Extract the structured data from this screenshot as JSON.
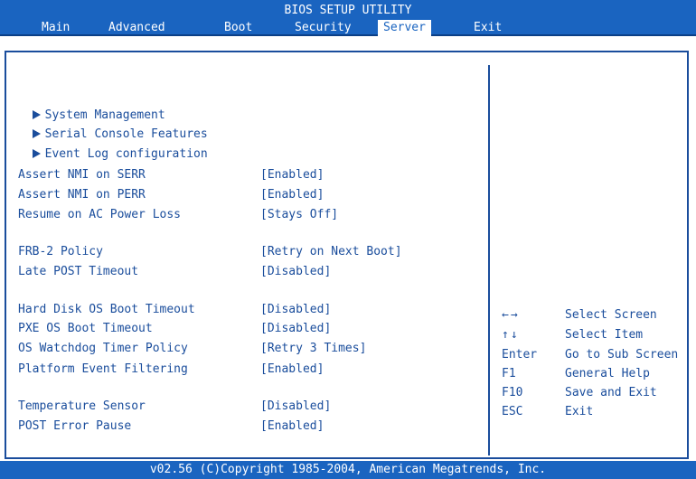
{
  "title": "BIOS SETUP UTILITY",
  "menu": [
    {
      "label": "Main"
    },
    {
      "label": "Advanced"
    },
    {
      "label": "Boot"
    },
    {
      "label": "Security"
    },
    {
      "label": "Server"
    },
    {
      "label": "Exit"
    }
  ],
  "active_menu": "Server",
  "submenus": [
    {
      "label": "System Management"
    },
    {
      "label": "Serial Console Features"
    },
    {
      "label": "Event Log configuration"
    }
  ],
  "settings": [
    {
      "label": "Assert NMI on SERR",
      "value": "[Enabled]"
    },
    {
      "label": "Assert NMI on PERR",
      "value": "[Enabled]"
    },
    {
      "label": "Resume on AC Power Loss",
      "value": "[Stays Off]"
    },
    {
      "label": "FRB-2 Policy",
      "value": "[Retry on Next Boot]"
    },
    {
      "label": "Late POST Timeout",
      "value": "[Disabled]"
    },
    {
      "label": "Hard Disk OS Boot Timeout",
      "value": "[Disabled]"
    },
    {
      "label": "PXE OS Boot Timeout",
      "value": "[Disabled]"
    },
    {
      "label": "OS Watchdog Timer Policy",
      "value": "[Retry 3 Times]"
    },
    {
      "label": "Platform Event Filtering",
      "value": "[Enabled]"
    },
    {
      "label": "Temperature Sensor",
      "value": "[Disabled]"
    },
    {
      "label": "POST Error Pause",
      "value": "[Enabled]"
    }
  ],
  "help": [
    {
      "key": "←→",
      "desc": "Select Screen"
    },
    {
      "key": "↑↓",
      "desc": "Select Item"
    },
    {
      "key": "Enter",
      "desc": "Go to Sub Screen"
    },
    {
      "key": "F1",
      "desc": "General Help"
    },
    {
      "key": "F10",
      "desc": "Save and Exit"
    },
    {
      "key": "ESC",
      "desc": "Exit"
    }
  ],
  "footer": "v02.56 (C)Copyright 1985-2004, American Megatrends, Inc.",
  "colors": {
    "bar": "#1a64c0",
    "text": "#1a4d9c",
    "background": "#ffffff"
  }
}
